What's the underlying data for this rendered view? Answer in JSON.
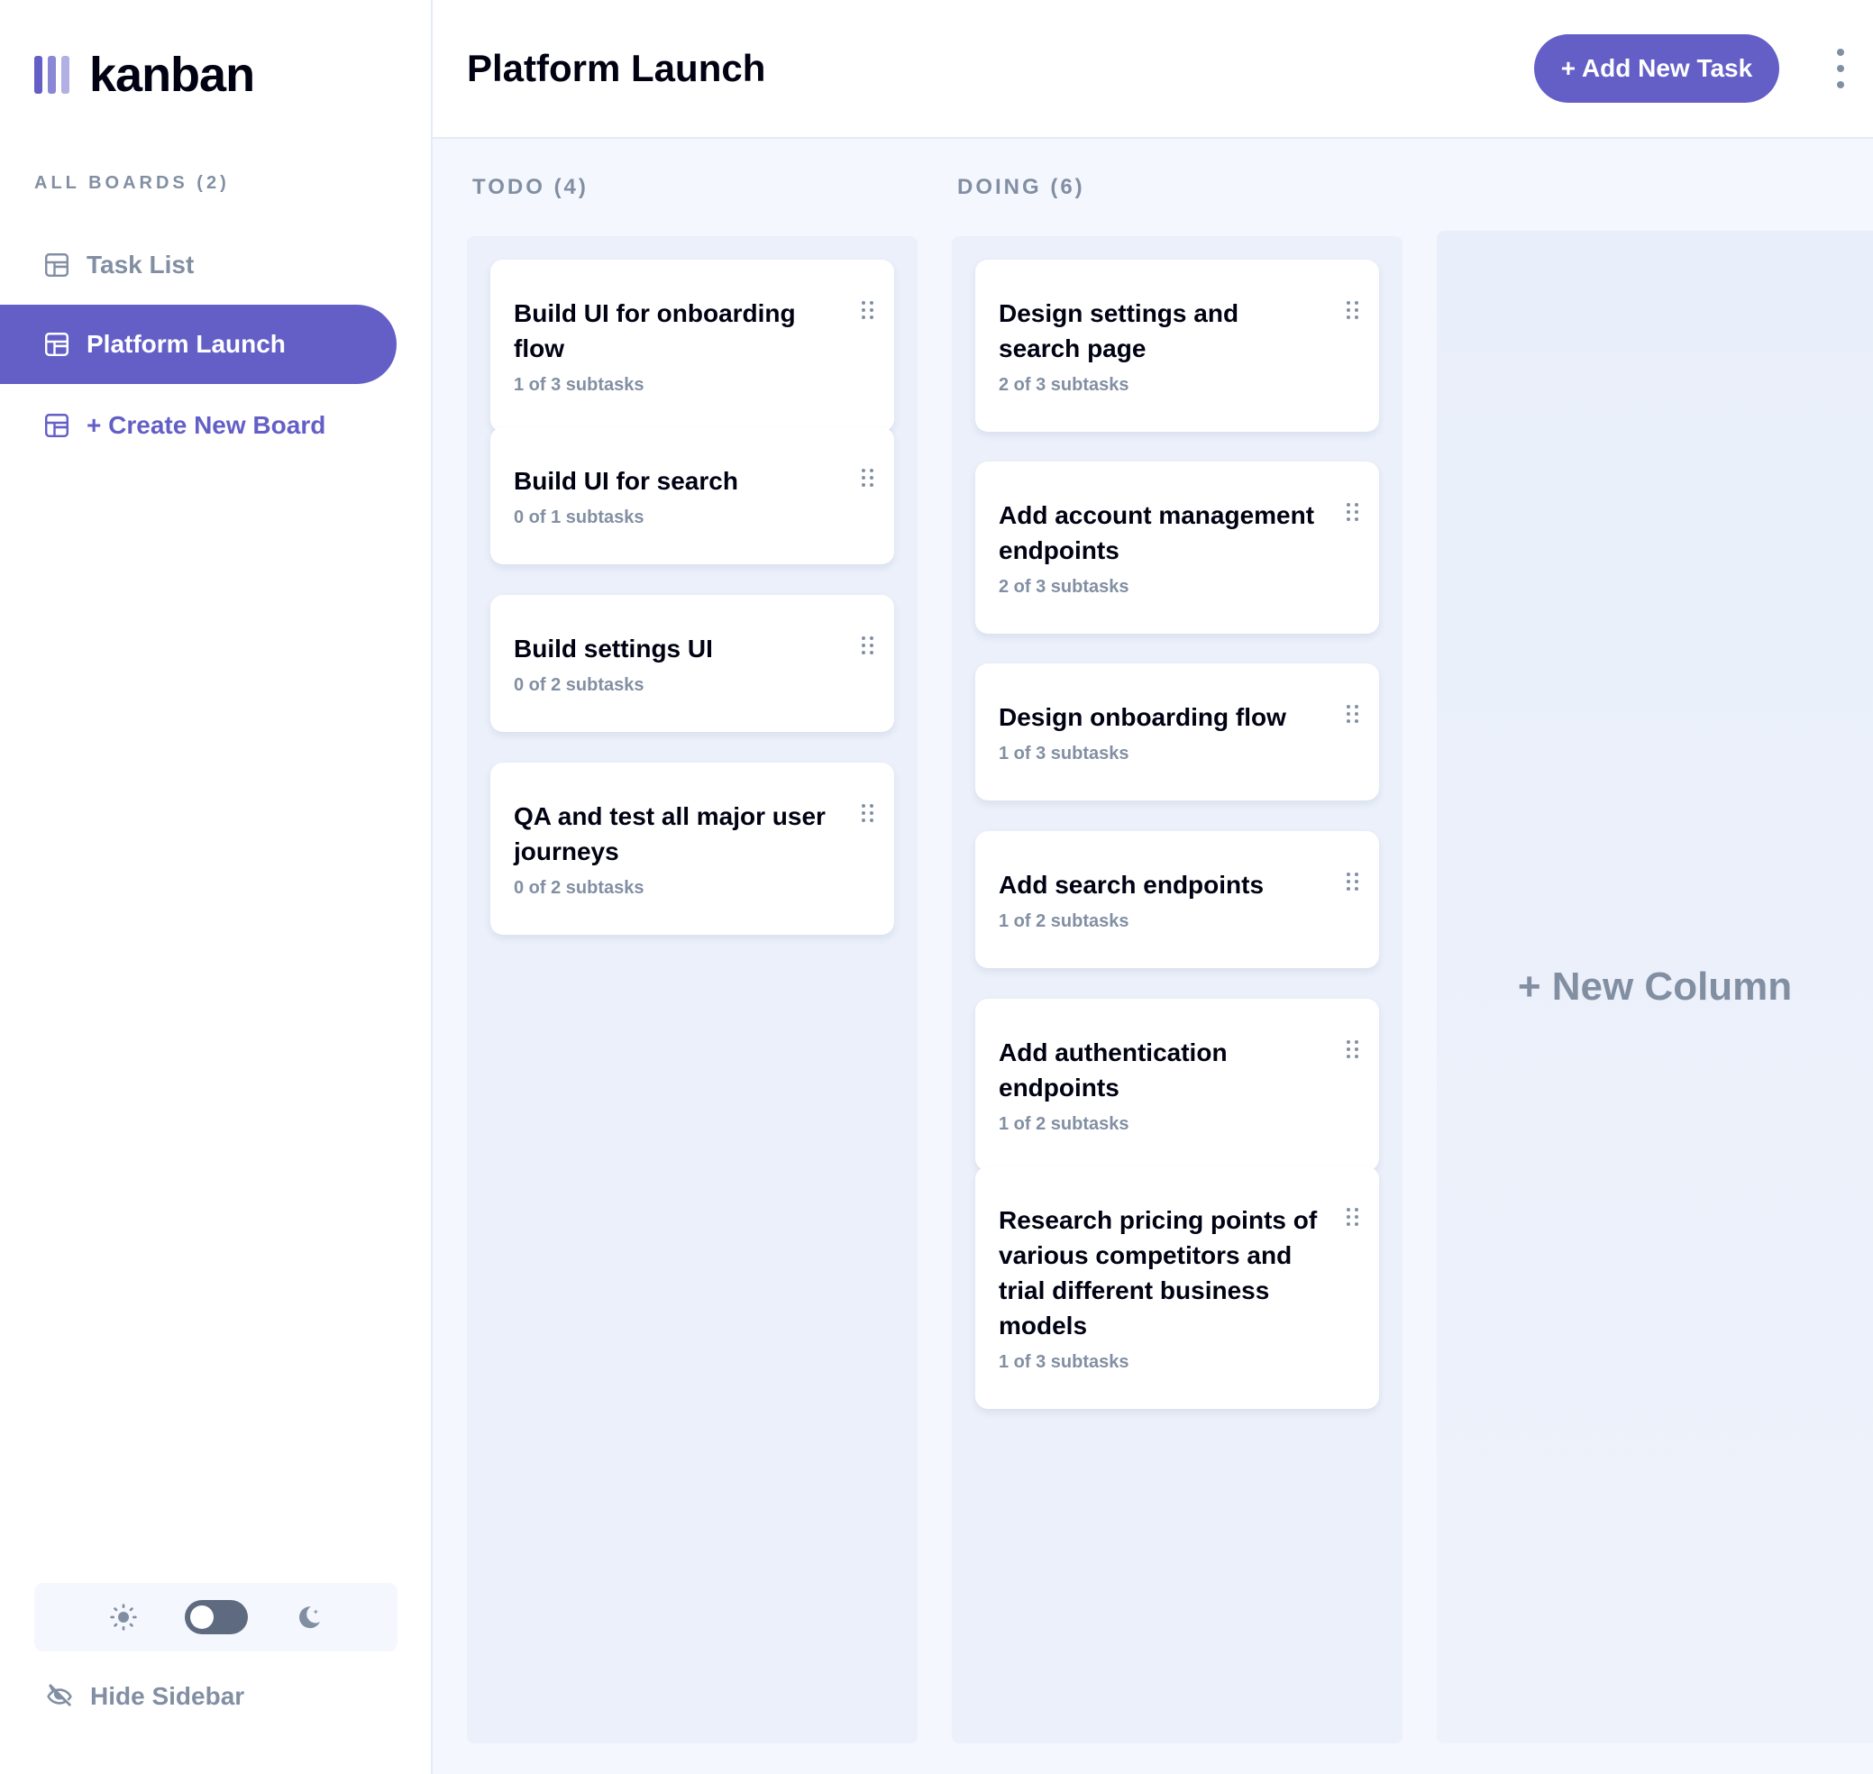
{
  "app": {
    "logo_text": "kanban",
    "accent_color": "#635FC7"
  },
  "sidebar": {
    "boards_heading": "ALL BOARDS (2)",
    "items": [
      {
        "label": "Task List",
        "icon": "board-icon",
        "active": false
      },
      {
        "label": "Platform Launch",
        "icon": "board-icon",
        "active": true
      }
    ],
    "create_label": "+ Create New Board",
    "hide_label": "Hide Sidebar",
    "theme": {
      "light_icon": "sun-icon",
      "dark_icon": "moon-icon",
      "mode": "light"
    }
  },
  "header": {
    "title": "Platform Launch",
    "add_task_label": "+ Add New Task",
    "more_icon": "vertical-ellipsis-icon"
  },
  "columns": [
    {
      "title": "TODO (4)",
      "tasks": [
        {
          "title": "Build UI for onboarding flow",
          "subtasks": "1 of 3 subtasks"
        },
        {
          "title": "Build UI for search",
          "subtasks": "0 of 1 subtasks"
        },
        {
          "title": "Build settings UI",
          "subtasks": "0 of 2 subtasks"
        },
        {
          "title": "QA and test all major user journeys",
          "subtasks": "0 of 2 subtasks"
        }
      ]
    },
    {
      "title": "DOING (6)",
      "tasks": [
        {
          "title": "Design settings and search page",
          "subtasks": "2 of 3 subtasks"
        },
        {
          "title": "Add account management endpoints",
          "subtasks": "2 of 3 subtasks"
        },
        {
          "title": "Design onboarding flow",
          "subtasks": "1 of 3 subtasks"
        },
        {
          "title": "Add search endpoints",
          "subtasks": "1 of 2 subtasks"
        },
        {
          "title": "Add authentication endpoints",
          "subtasks": "1 of 2 subtasks"
        },
        {
          "title": "Research pricing points of various competitors and trial different business models",
          "subtasks": "1 of 3 subtasks"
        }
      ]
    }
  ],
  "new_column_label": "+ New Column"
}
